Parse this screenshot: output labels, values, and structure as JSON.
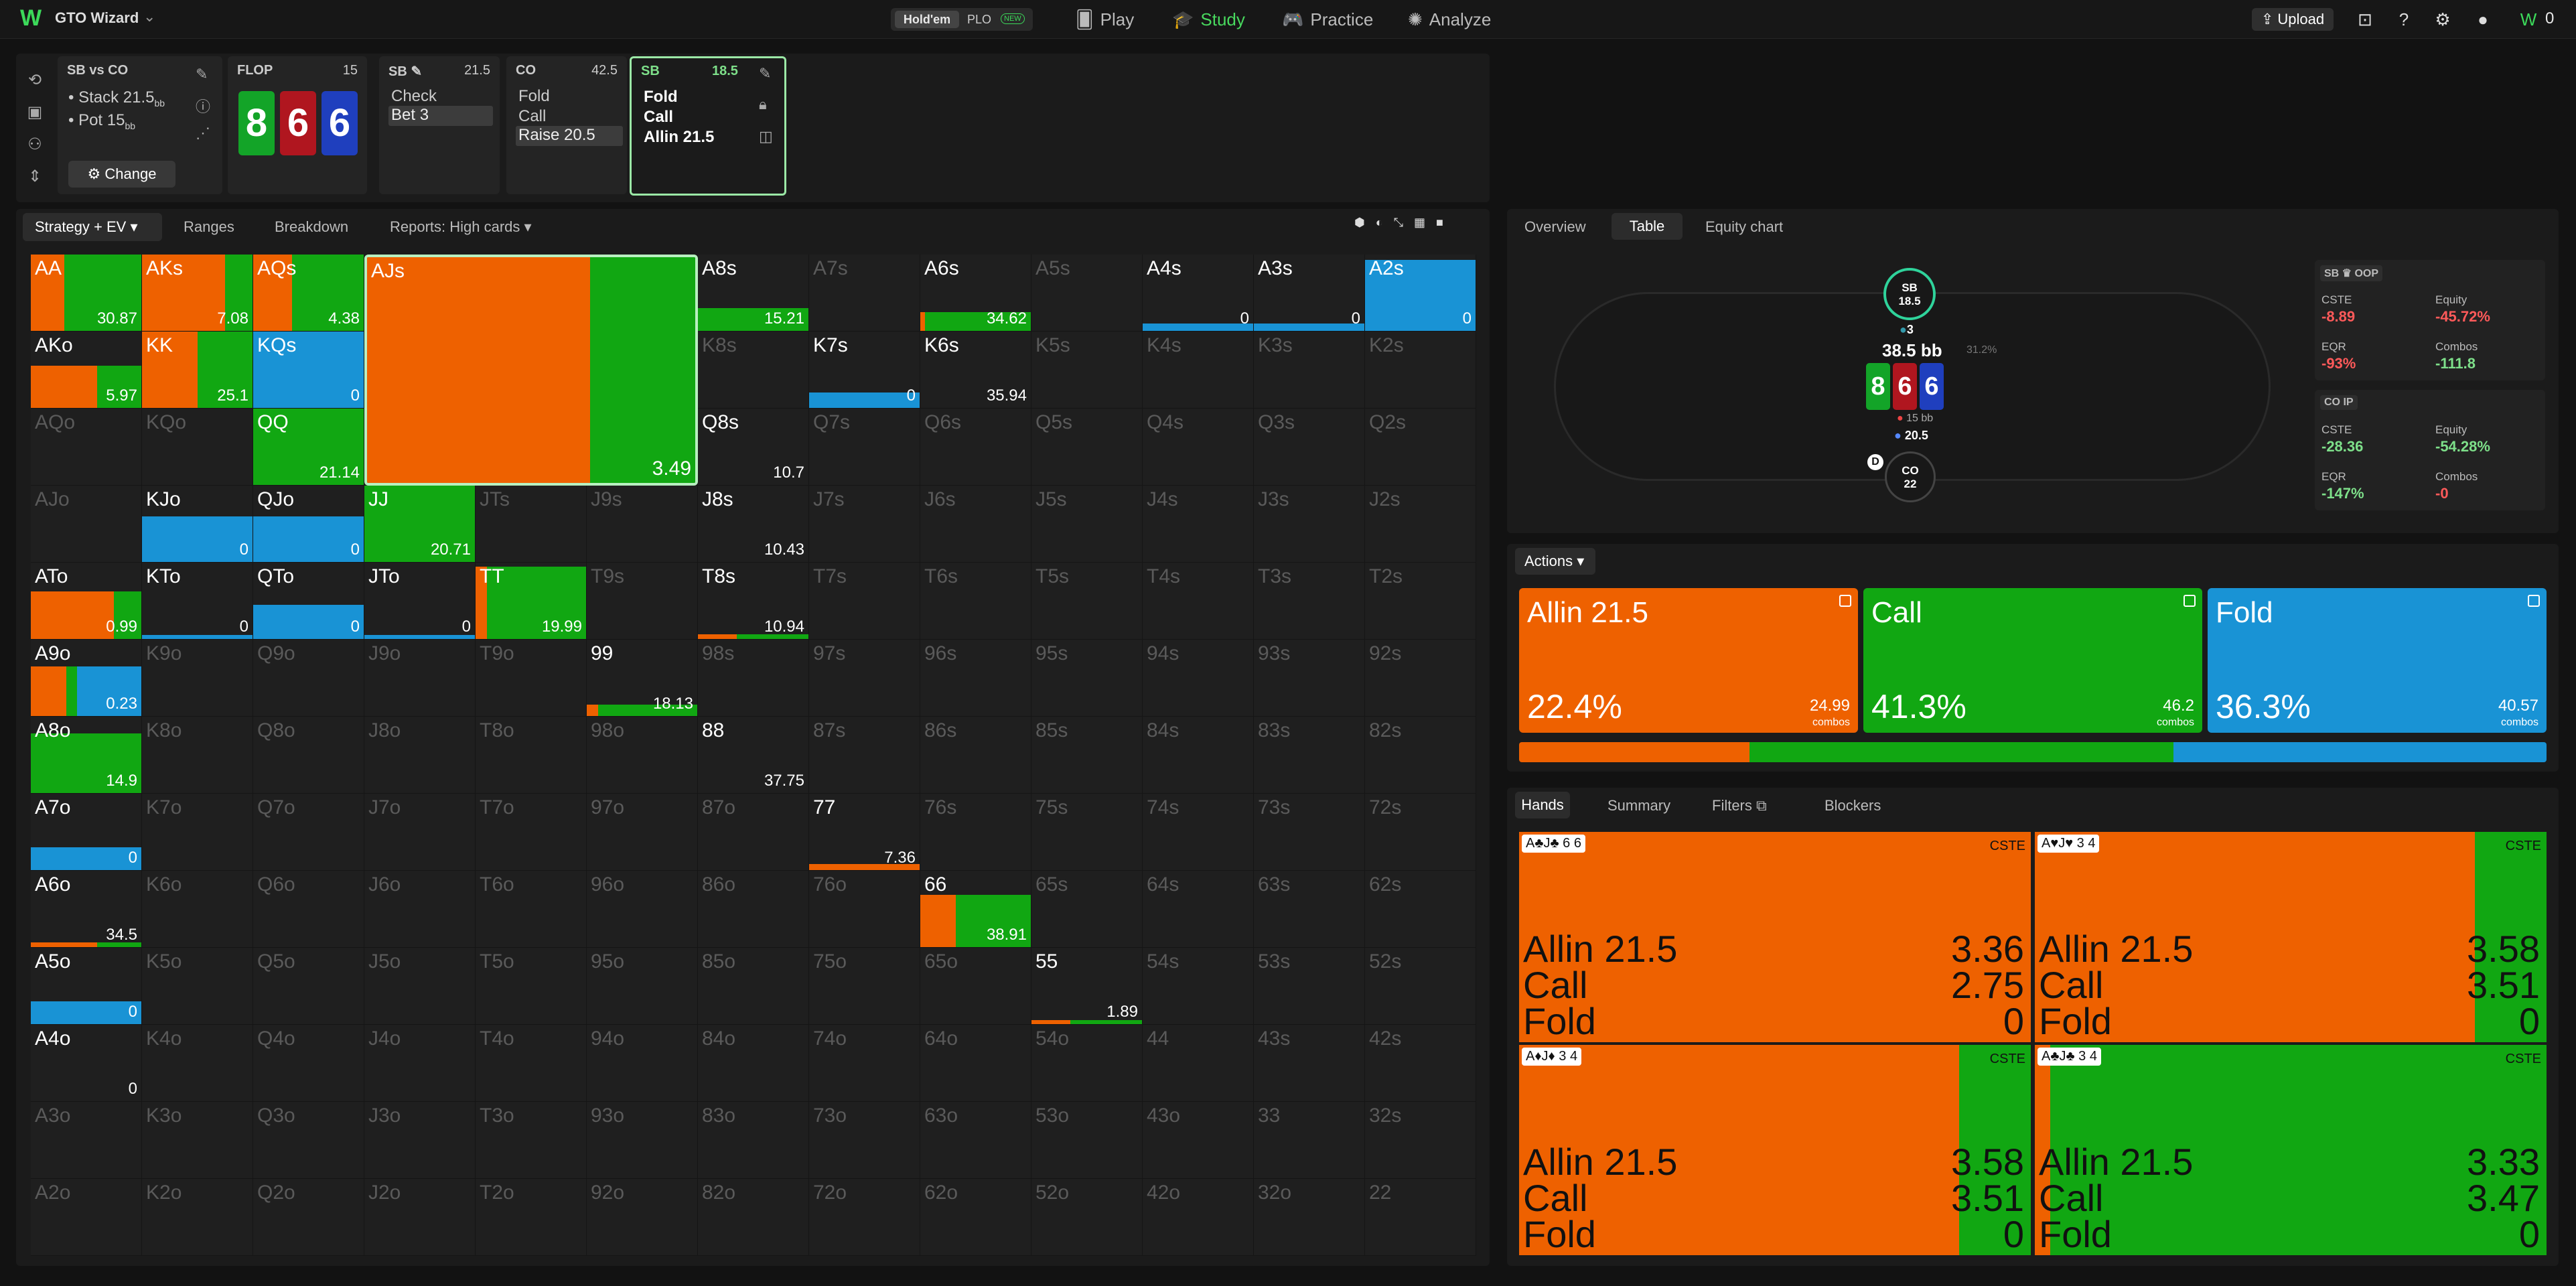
{
  "app": {
    "title": "GTO Wizard"
  },
  "game_toggle": {
    "holdem": "Hold'em",
    "plo": "PLO",
    "new_badge": "NEW"
  },
  "nav": {
    "play": "Play",
    "study": "Study",
    "practice": "Practice",
    "analyze": "Analyze"
  },
  "topright": {
    "upload": "Upload",
    "coins": "0"
  },
  "spot": {
    "title": "SB vs CO",
    "stack": "Stack 21.5",
    "pot": "Pot 15",
    "bb": "bb",
    "change": "Change"
  },
  "flop": {
    "label": "FLOP",
    "pot": "15",
    "cards": [
      "8",
      "6",
      "6"
    ],
    "card_colors": [
      "#13a428",
      "#b0161f",
      "#1f3fbe"
    ]
  },
  "sb_node": {
    "label": "SB",
    "value": "21.5",
    "actions": [
      "Check",
      "Bet 3"
    ]
  },
  "co_node": {
    "label": "CO",
    "value": "42.5",
    "actions": [
      "Fold",
      "Call",
      "Raise 20.5"
    ]
  },
  "sb_active": {
    "label": "SB",
    "value": "18.5",
    "actions": [
      "Fold",
      "Call",
      "Allin 21.5"
    ]
  },
  "toolbar": {
    "strategy": "Strategy + EV",
    "ranges": "Ranges",
    "breakdown": "Breakdown",
    "reports": "Reports: High cards"
  },
  "grid": {
    "ranks": [
      "A",
      "K",
      "Q",
      "J",
      "T",
      "9",
      "8",
      "7",
      "6",
      "5",
      "4",
      "3",
      "2"
    ],
    "colors": {
      "allin": "#ee6100",
      "call": "#11a712",
      "fold": "#1993d5"
    },
    "active": [
      {
        "h": "AA",
        "s": [
          0,
          0.3,
          0.7,
          0
        ],
        "ev": "30.87",
        "f": 1
      },
      {
        "h": "AKs",
        "s": [
          0,
          0.75,
          0.25,
          0
        ],
        "ev": "7.08",
        "f": 1
      },
      {
        "h": "AQs",
        "s": [
          0,
          0.35,
          0.65,
          0
        ],
        "ev": "4.38",
        "f": 1
      },
      {
        "h": "A8s",
        "s": [
          0,
          0,
          1,
          0
        ],
        "ev": "15.21",
        "f": 0.3
      },
      {
        "h": "A6s",
        "s": [
          0,
          0.04,
          0.96,
          0
        ],
        "ev": "34.62",
        "f": 0.25
      },
      {
        "h": "A4s",
        "s": [
          0,
          0,
          0,
          1
        ],
        "ev": "0",
        "f": 0.1
      },
      {
        "h": "A3s",
        "s": [
          0,
          0,
          0,
          1
        ],
        "ev": "0",
        "f": 0.1
      },
      {
        "h": "A2s",
        "s": [
          0,
          0,
          0,
          1
        ],
        "ev": "0",
        "f": 0.93
      },
      {
        "h": "AKo",
        "s": [
          0,
          0.6,
          0.4,
          0
        ],
        "ev": "5.97",
        "f": 0.55
      },
      {
        "h": "KK",
        "s": [
          0,
          0.5,
          0.5,
          0
        ],
        "ev": "25.1",
        "f": 1
      },
      {
        "h": "KQs",
        "s": [
          0,
          0,
          0,
          1
        ],
        "ev": "0",
        "f": 1
      },
      {
        "h": "K7s",
        "s": [
          0,
          0,
          0,
          1
        ],
        "ev": "0",
        "f": 0.2
      },
      {
        "h": "K6s",
        "s": [
          0,
          0,
          0,
          0
        ],
        "ev": "35.94",
        "f": 0
      },
      {
        "h": "QQ",
        "s": [
          0,
          0,
          1,
          0
        ],
        "ev": "21.14",
        "f": 1
      },
      {
        "h": "Q8s",
        "s": [
          0,
          0,
          0,
          0
        ],
        "ev": "10.7",
        "f": 0
      },
      {
        "h": "KJo",
        "s": [
          0,
          0,
          0,
          1
        ],
        "ev": "0",
        "f": 0.6
      },
      {
        "h": "QJo",
        "s": [
          0,
          0,
          0,
          1
        ],
        "ev": "0",
        "f": 0.6
      },
      {
        "h": "JJ",
        "s": [
          0,
          0,
          1,
          0
        ],
        "ev": "20.71",
        "f": 1
      },
      {
        "h": "J8s",
        "s": [
          0,
          0,
          0,
          0
        ],
        "ev": "10.43",
        "f": 0
      },
      {
        "h": "ATo",
        "s": [
          0,
          0.75,
          0.25,
          0
        ],
        "ev": "0.99",
        "f": 0.62
      },
      {
        "h": "KTo",
        "s": [
          0,
          0,
          0,
          1
        ],
        "ev": "0",
        "f": 0.05
      },
      {
        "h": "QTo",
        "s": [
          0,
          0,
          0,
          1
        ],
        "ev": "0",
        "f": 0.45
      },
      {
        "h": "JTo",
        "s": [
          0,
          0,
          0,
          1
        ],
        "ev": "0",
        "f": 0.05
      },
      {
        "h": "TT",
        "s": [
          0,
          0.1,
          0.9,
          0
        ],
        "ev": "19.99",
        "f": 0.95
      },
      {
        "h": "T8s",
        "s": [
          0,
          0.35,
          0.65,
          0
        ],
        "ev": "10.94",
        "f": 0.06
      },
      {
        "h": "A9o",
        "s": [
          0,
          0.32,
          0.1,
          0.58
        ],
        "ev": "0.23",
        "f": 0.65
      },
      {
        "h": "99",
        "s": [
          0,
          0.1,
          0.9,
          0
        ],
        "ev": "18.13",
        "f": 0.15
      },
      {
        "h": "A8o",
        "s": [
          0,
          0,
          1,
          0
        ],
        "ev": "14.9",
        "f": 0.78
      },
      {
        "h": "88",
        "s": [
          0,
          0,
          0,
          0
        ],
        "ev": "37.75",
        "f": 0
      },
      {
        "h": "A7o",
        "s": [
          0,
          0,
          0,
          1
        ],
        "ev": "0",
        "f": 0.3
      },
      {
        "h": "77",
        "s": [
          0,
          1,
          0,
          0
        ],
        "ev": "7.36",
        "f": 0.08
      },
      {
        "h": "A6o",
        "s": [
          0,
          0.6,
          0.4,
          0
        ],
        "ev": "34.5",
        "f": 0.06
      },
      {
        "h": "66",
        "s": [
          0,
          0.32,
          0.68,
          0
        ],
        "ev": "38.91",
        "f": 0.68
      },
      {
        "h": "A5o",
        "s": [
          0,
          0,
          0,
          1
        ],
        "ev": "0",
        "f": 0.3
      },
      {
        "h": "55",
        "s": [
          0,
          0.35,
          0.65,
          0
        ],
        "ev": "1.89",
        "f": 0.05
      },
      {
        "h": "A4o",
        "s": [
          0,
          0,
          0,
          0
        ],
        "ev": "0",
        "f": 0
      }
    ],
    "selected": {
      "h": "AJs",
      "s": [
        0,
        0.68,
        0.32,
        0
      ],
      "ev": "3.49"
    }
  },
  "right_tabs": {
    "overview": "Overview",
    "table": "Table",
    "equity": "Equity chart"
  },
  "table": {
    "sb": {
      "name": "SB",
      "stack": "18.5"
    },
    "co": {
      "name": "CO",
      "stack": "22"
    },
    "bet_count": "3",
    "pot": "38.5 bb",
    "pot_pct": "31.2%",
    "sb_bet": "15 bb",
    "co_bet": "20.5",
    "dealer": "D",
    "board": [
      "8",
      "6",
      "6"
    ]
  },
  "stats": {
    "oop": {
      "title": "SB",
      "tag": "OOP",
      "cste_l": "CSTE",
      "cste": "-8.89",
      "eq_l": "Equity",
      "eq": "-45.72%",
      "eqr_l": "EQR",
      "eqr": "-93%",
      "comb_l": "Combos",
      "comb": "-111.8"
    },
    "ip": {
      "title": "CO",
      "tag": "IP",
      "cste_l": "CSTE",
      "cste": "-28.36",
      "eq_l": "Equity",
      "eq": "-54.28%",
      "eqr_l": "EQR",
      "eqr": "-147%",
      "comb_l": "Combos",
      "comb": "-0"
    }
  },
  "actions": {
    "title": "Actions",
    "items": [
      {
        "label": "Allin 21.5",
        "pct": "22.4%",
        "combos": "24.99",
        "combos_label": "combos",
        "color": "#ee6100"
      },
      {
        "label": "Call",
        "pct": "41.3%",
        "combos": "46.2",
        "combos_label": "combos",
        "color": "#11a712"
      },
      {
        "label": "Fold",
        "pct": "36.3%",
        "combos": "40.57",
        "combos_label": "combos",
        "color": "#1993d5"
      }
    ],
    "bar": [
      22.4,
      41.3,
      36.3
    ]
  },
  "bottom_tabs": {
    "hands": "Hands",
    "summary": "Summary",
    "filters": "Filters",
    "blockers": "Blockers"
  },
  "hands": [
    {
      "cards": "A♣J♣",
      "extra": "6 6",
      "cste": "CSTE",
      "green": 0,
      "rows": [
        [
          "Allin 21.5",
          "3.36"
        ],
        [
          "Call",
          "2.75"
        ],
        [
          "Fold",
          "0"
        ]
      ]
    },
    {
      "cards": "A♥J♥",
      "extra": "3 4",
      "cste": "CSTE",
      "green": 0.14,
      "rows": [
        [
          "Allin 21.5",
          "3.58"
        ],
        [
          "Call",
          "3.51"
        ],
        [
          "Fold",
          "0"
        ]
      ]
    },
    {
      "cards": "A♦J♦",
      "extra": "3 4",
      "cste": "CSTE",
      "green": 0.14,
      "rows": [
        [
          "Allin 21.5",
          "3.58"
        ],
        [
          "Call",
          "3.51"
        ],
        [
          "Fold",
          "0"
        ]
      ]
    },
    {
      "cards": "A♣J♣",
      "extra": "3 4",
      "cste": "CSTE",
      "green": 0.97,
      "rows": [
        [
          "Allin 21.5",
          "3.33"
        ],
        [
          "Call",
          "3.47"
        ],
        [
          "Fold",
          "0"
        ]
      ]
    }
  ]
}
